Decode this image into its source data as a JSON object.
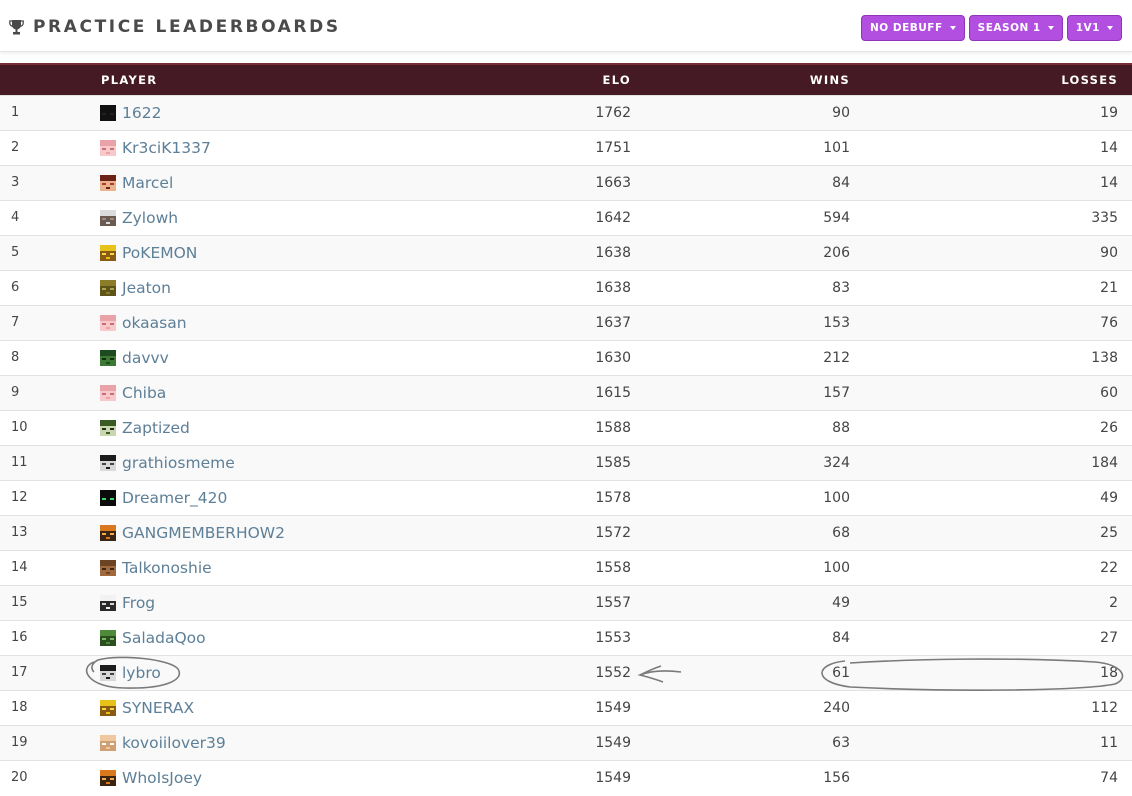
{
  "header": {
    "title": "PRACTICE LEADERBOARDS",
    "filters": [
      {
        "label": "NO DEBUFF"
      },
      {
        "label": "SEASON 1"
      },
      {
        "label": "1V1"
      }
    ]
  },
  "table": {
    "columns": {
      "player": "PLAYER",
      "elo": "ELO",
      "wins": "WINS",
      "losses": "LOSSES"
    },
    "rows": [
      {
        "rank": "1",
        "player": "1622",
        "elo": "1762",
        "wins": "90",
        "losses": "19",
        "avatar": "black-skin"
      },
      {
        "rank": "2",
        "player": "Kr3ciK1337",
        "elo": "1751",
        "wins": "101",
        "losses": "14",
        "avatar": "pink-skin"
      },
      {
        "rank": "3",
        "player": "Marcel",
        "elo": "1663",
        "wins": "84",
        "losses": "14",
        "avatar": "red-skin"
      },
      {
        "rank": "4",
        "player": "Zylowh",
        "elo": "1642",
        "wins": "594",
        "losses": "335",
        "avatar": "cat-skin"
      },
      {
        "rank": "5",
        "player": "PoKEMON",
        "elo": "1638",
        "wins": "206",
        "losses": "90",
        "avatar": "yellow-skin"
      },
      {
        "rank": "6",
        "player": "Jeaton",
        "elo": "1638",
        "wins": "83",
        "losses": "21",
        "avatar": "olive-skin"
      },
      {
        "rank": "7",
        "player": "okaasan",
        "elo": "1637",
        "wins": "153",
        "losses": "76",
        "avatar": "pink-skin"
      },
      {
        "rank": "8",
        "player": "davvv",
        "elo": "1630",
        "wins": "212",
        "losses": "138",
        "avatar": "green-skin"
      },
      {
        "rank": "9",
        "player": "Chiba",
        "elo": "1615",
        "wins": "157",
        "losses": "60",
        "avatar": "pink-skin"
      },
      {
        "rank": "10",
        "player": "Zaptized",
        "elo": "1588",
        "wins": "88",
        "losses": "26",
        "avatar": "camo-skin"
      },
      {
        "rank": "11",
        "player": "grathiosmeme",
        "elo": "1585",
        "wins": "324",
        "losses": "184",
        "avatar": "dark-skin"
      },
      {
        "rank": "12",
        "player": "Dreamer_420",
        "elo": "1578",
        "wins": "100",
        "losses": "49",
        "avatar": "enderman-skin"
      },
      {
        "rank": "13",
        "player": "GANGMEMBERHOW2",
        "elo": "1572",
        "wins": "68",
        "losses": "25",
        "avatar": "orange-skin"
      },
      {
        "rank": "14",
        "player": "Talkonoshie",
        "elo": "1558",
        "wins": "100",
        "losses": "22",
        "avatar": "brown-skin"
      },
      {
        "rank": "15",
        "player": "Frog",
        "elo": "1557",
        "wins": "49",
        "losses": "2",
        "avatar": "panda-skin"
      },
      {
        "rank": "16",
        "player": "SaladaQoo",
        "elo": "1553",
        "wins": "84",
        "losses": "27",
        "avatar": "creeper-skin"
      },
      {
        "rank": "17",
        "player": "lybro",
        "elo": "1552",
        "wins": "61",
        "losses": "18",
        "avatar": "dark-skin"
      },
      {
        "rank": "18",
        "player": "SYNERAX",
        "elo": "1549",
        "wins": "240",
        "losses": "112",
        "avatar": "yellow-skin"
      },
      {
        "rank": "19",
        "player": "kovoiilover39",
        "elo": "1549",
        "wins": "63",
        "losses": "11",
        "avatar": "tan-skin"
      },
      {
        "rank": "20",
        "player": "WhoIsJoey",
        "elo": "1549",
        "wins": "156",
        "losses": "74",
        "avatar": "orange-skin"
      }
    ]
  },
  "colors": {
    "header_bg": "#461a24",
    "filter_button": "#b24fe0",
    "player_link": "#5d7f97",
    "annotation": "#7a7a7a"
  }
}
